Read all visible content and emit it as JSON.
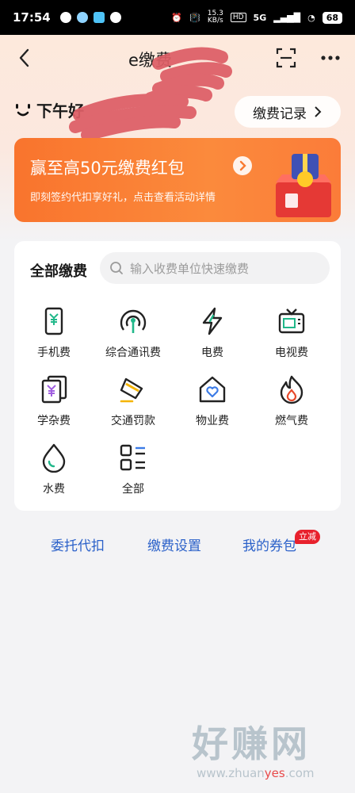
{
  "status_bar": {
    "time": "17:54",
    "net_speed_value": "15.3",
    "net_speed_unit": "KB/s",
    "hd": "HD",
    "signal": "5G",
    "battery": "68"
  },
  "nav": {
    "title": "e缴费"
  },
  "greeting": {
    "text": "下午好"
  },
  "record_button": {
    "label": "缴费记录",
    "icon": "chevron-right-icon"
  },
  "banner": {
    "title": "赢至高50元缴费红包",
    "subtitle": "即刻签约代扣享好礼，点击查看活动详情",
    "bg_color": "#f97a30"
  },
  "payments": {
    "title": "全部缴费",
    "search_placeholder": "输入收费单位快速缴费",
    "items": [
      {
        "label": "手机费",
        "icon": "phone-bill-icon"
      },
      {
        "label": "综合通讯费",
        "icon": "signal-tower-icon"
      },
      {
        "label": "电费",
        "icon": "lightning-icon"
      },
      {
        "label": "电视费",
        "icon": "tv-icon"
      },
      {
        "label": "学杂费",
        "icon": "tuition-icon"
      },
      {
        "label": "交通罚款",
        "icon": "traffic-fine-icon"
      },
      {
        "label": "物业费",
        "icon": "house-heart-icon"
      },
      {
        "label": "燃气费",
        "icon": "flame-icon"
      },
      {
        "label": "水费",
        "icon": "water-drop-icon"
      },
      {
        "label": "全部",
        "icon": "grid-list-icon"
      }
    ]
  },
  "links": {
    "entrust": "委托代扣",
    "settings": "缴费设置",
    "coupons": "我的券包",
    "coupon_badge": "立减"
  },
  "accent_color": "#2b61c9",
  "icon_accent_green": "#21b88a",
  "watermark": {
    "cn": "好赚网",
    "domain_prefix": "www.zhuan",
    "domain_highlight": "yes",
    "domain_suffix": ".com"
  }
}
